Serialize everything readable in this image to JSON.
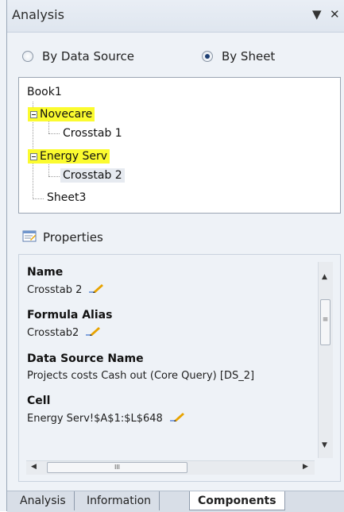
{
  "window": {
    "title": "Analysis",
    "dropdown_glyph": "▼",
    "close_glyph": "✕"
  },
  "view_mode": {
    "options": [
      {
        "label": "By Data Source",
        "selected": false
      },
      {
        "label": "By Sheet",
        "selected": true
      }
    ]
  },
  "tree": {
    "root": "Book1",
    "nodes": [
      {
        "label": "Novecare",
        "expanded": true,
        "highlighted": true
      },
      {
        "label": "Crosstab 1"
      },
      {
        "label": "Energy Serv",
        "expanded": true,
        "highlighted": true
      },
      {
        "label": "Crosstab 2",
        "selected": true
      },
      {
        "label": "Sheet3"
      }
    ]
  },
  "properties": {
    "header": "Properties",
    "items": [
      {
        "name": "Name",
        "value": "Crosstab 2",
        "editable": true
      },
      {
        "name": "Formula Alias",
        "value": "Crosstab2",
        "editable": true
      },
      {
        "name": "Data Source Name",
        "value": "Projects costs  Cash out (Core Query) [DS_2]",
        "editable": false
      },
      {
        "name": "Cell",
        "value": "Energy Serv!$A$1:$L$648",
        "editable": true
      }
    ]
  },
  "scrollbar": {
    "up": "▲",
    "down": "▼",
    "left": "◀",
    "right": "▶",
    "vthumb_grip": "≡",
    "hthumb_grip": "III"
  },
  "tabs": [
    {
      "label": "Analysis",
      "active": false
    },
    {
      "label": "Information",
      "active": false
    },
    {
      "label": "Components",
      "active": true
    }
  ],
  "colors": {
    "highlight": "#fbfb2f",
    "panel_bg": "#eef2f7",
    "pencil_orange": "#e8a300",
    "pencil_blue": "#3b6fcf"
  },
  "icons": {
    "properties": "properties-icon",
    "edit": "pencil-icon"
  }
}
